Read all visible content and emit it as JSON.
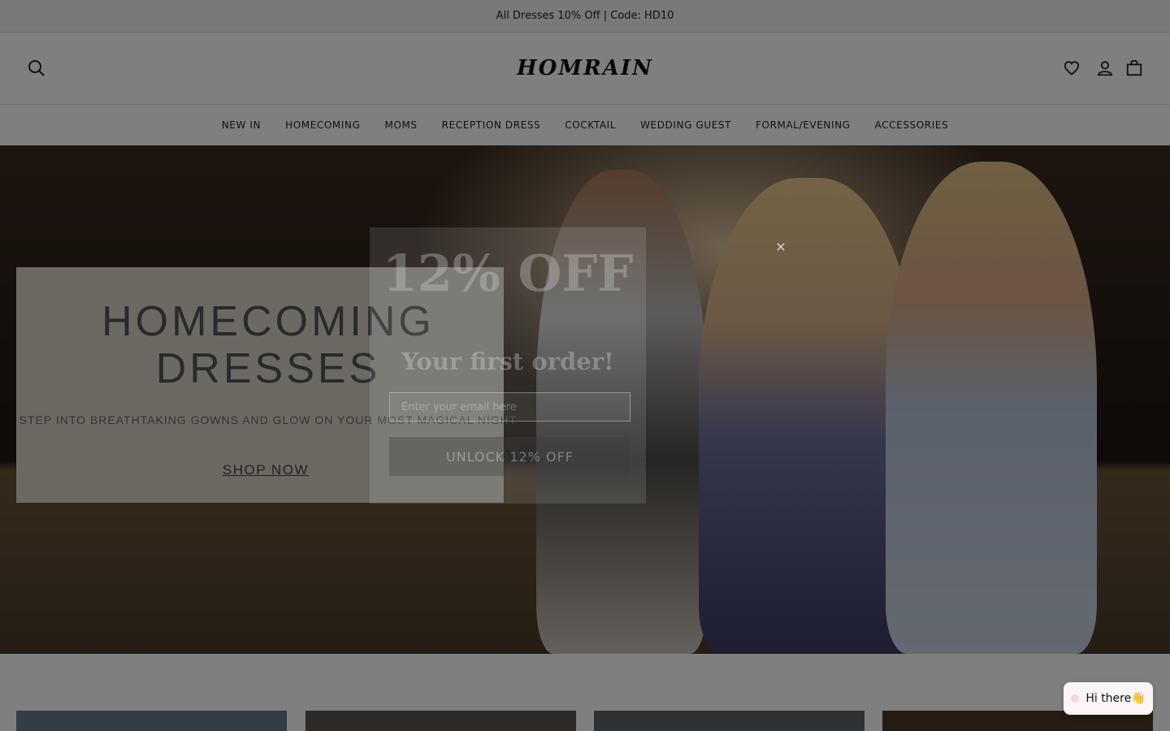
{
  "announcement": "All Dresses 10% Off | Code: HD10",
  "header": {
    "logo": "HOMRAIN"
  },
  "nav": {
    "items": [
      {
        "label": "NEW IN"
      },
      {
        "label": "HOMECOMING"
      },
      {
        "label": "MOMS"
      },
      {
        "label": "RECEPTION DRESS"
      },
      {
        "label": "COCKTAIL"
      },
      {
        "label": "WEDDING GUEST"
      },
      {
        "label": "FORMAL/EVENING"
      },
      {
        "label": "ACCESSORIES"
      }
    ]
  },
  "hero": {
    "title": "HOMECOMING DRESSES",
    "subtitle": "STEP INTO BREATHTAKING GOWNS AND GLOW ON YOUR MOST MAGICAL NIGHT",
    "cta": "SHOP NOW"
  },
  "popup": {
    "headline": "12% OFF",
    "subheadline": "Your first order!",
    "input_placeholder": "Enter your email here",
    "button_label": "UNLOCK 12% OFF",
    "close_symbol": "×"
  },
  "chat": {
    "label": "Hi there👋"
  },
  "icons": {
    "search": "search-icon",
    "wishlist": "heart-icon",
    "account": "user-icon",
    "bag": "bag-icon",
    "close": "close-icon"
  }
}
